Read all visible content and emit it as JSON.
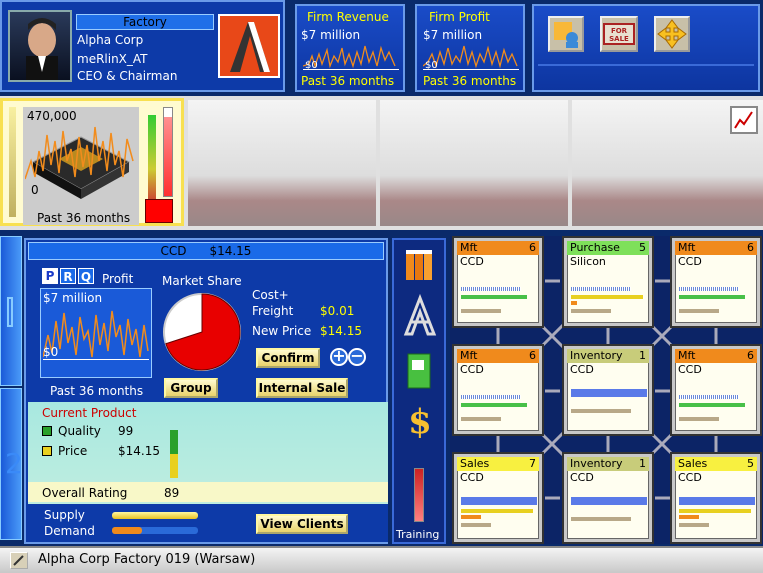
{
  "header": {
    "firm_type": "Factory",
    "company": "Alpha Corp",
    "player": "meRlinX_AT",
    "role": "CEO & Chairman",
    "revenue": {
      "title": "Firm Revenue",
      "value": "$7 million",
      "zero": "$0",
      "period": "Past 36 months"
    },
    "profit": {
      "title": "Firm Profit",
      "value": "$7 million",
      "zero": "$0",
      "period": "Past 36 months"
    }
  },
  "product_strip": {
    "max": "470,000",
    "zero": "0",
    "period": "Past 36 months"
  },
  "detail": {
    "product": "CCD",
    "price_top": "$14.15",
    "tabs": [
      "P",
      "R",
      "Q"
    ],
    "profit_label": "Profit",
    "profit_value": "$7 million",
    "profit_zero": "$0",
    "profit_period": "Past 36 months",
    "market_share_label": "Market Share",
    "market_share": 0.7,
    "cost_freight_label": "Cost+\nFreight",
    "cost_freight_value": "$0.01",
    "new_price_label": "New Price",
    "new_price_value": "$14.15",
    "confirm": "Confirm",
    "group": "Group",
    "internal_sale": "Internal Sale",
    "current_product": "Current Product",
    "quality_label": "Quality",
    "quality_value": "99",
    "price_label": "Price",
    "price_value": "$14.15",
    "overall_label": "Overall Rating",
    "overall_value": "89",
    "supply_label": "Supply",
    "demand_label": "Demand",
    "view_clients": "View Clients"
  },
  "tools": {
    "training": "Training"
  },
  "nodes": [
    {
      "title": "Mft",
      "num": "6",
      "sub": "CCD",
      "color": "#f08a1c"
    },
    {
      "title": "Purchase",
      "num": "5",
      "sub": "Silicon",
      "color": "#7ee05a"
    },
    {
      "title": "Mft",
      "num": "6",
      "sub": "CCD",
      "color": "#f08a1c"
    },
    {
      "title": "Mft",
      "num": "6",
      "sub": "CCD",
      "color": "#f08a1c"
    },
    {
      "title": "Inventory",
      "num": "1",
      "sub": "CCD",
      "color": "#c8cc7a"
    },
    {
      "title": "Mft",
      "num": "6",
      "sub": "CCD",
      "color": "#f08a1c"
    },
    {
      "title": "Sales",
      "num": "7",
      "sub": "CCD",
      "color": "#f8f040"
    },
    {
      "title": "Inventory",
      "num": "1",
      "sub": "CCD",
      "color": "#c8cc7a"
    },
    {
      "title": "Sales",
      "num": "5",
      "sub": "CCD",
      "color": "#f8f040"
    }
  ],
  "status": {
    "text": "Alpha Corp Factory 019 (Warsaw)"
  }
}
